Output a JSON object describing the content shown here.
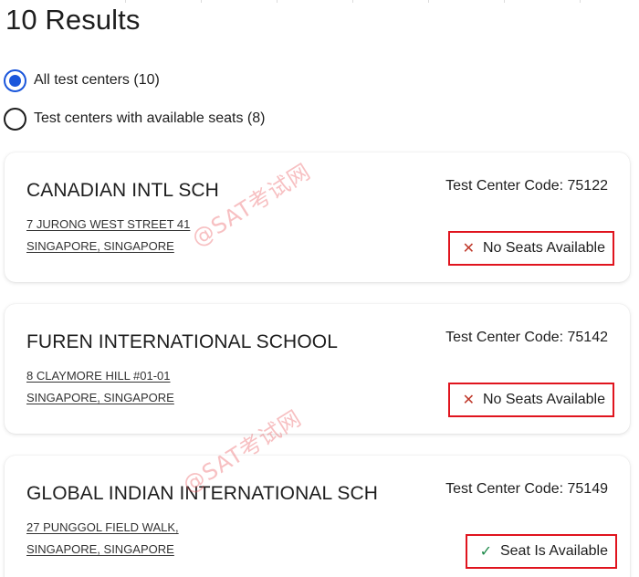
{
  "header": {
    "title": "10 Results"
  },
  "filters": [
    {
      "label": "All test centers (10)",
      "selected": true
    },
    {
      "label": "Test centers with available seats (8)",
      "selected": false
    }
  ],
  "centers": [
    {
      "name": "CANADIAN INTL SCH",
      "code": "Test Center Code: 75122",
      "address_line1": "7 JURONG WEST STREET 41",
      "address_line2": "SINGAPORE, SINGAPORE",
      "status": "No Seats Available",
      "status_icon": "x-icon"
    },
    {
      "name": "FUREN INTERNATIONAL SCHOOL",
      "code": "Test Center Code: 75142",
      "address_line1": "8 CLAYMORE HILL #01-01",
      "address_line2": "SINGAPORE, SINGAPORE",
      "status": "No Seats Available",
      "status_icon": "x-icon"
    },
    {
      "name": "GLOBAL INDIAN INTERNATIONAL SCH",
      "code": "Test Center Code: 75149",
      "address_line1": "27 PUNGGOL FIELD WALK,",
      "address_line2": "SINGAPORE, SINGAPORE",
      "status": "Seat Is Available",
      "status_icon": "check-icon"
    }
  ],
  "watermark": {
    "text": "@SAT考试网"
  },
  "colors": {
    "accent": "#1a56db",
    "highlight_border": "#e0141e",
    "unavailable": "#c0392b",
    "available": "#1e8a4a"
  }
}
